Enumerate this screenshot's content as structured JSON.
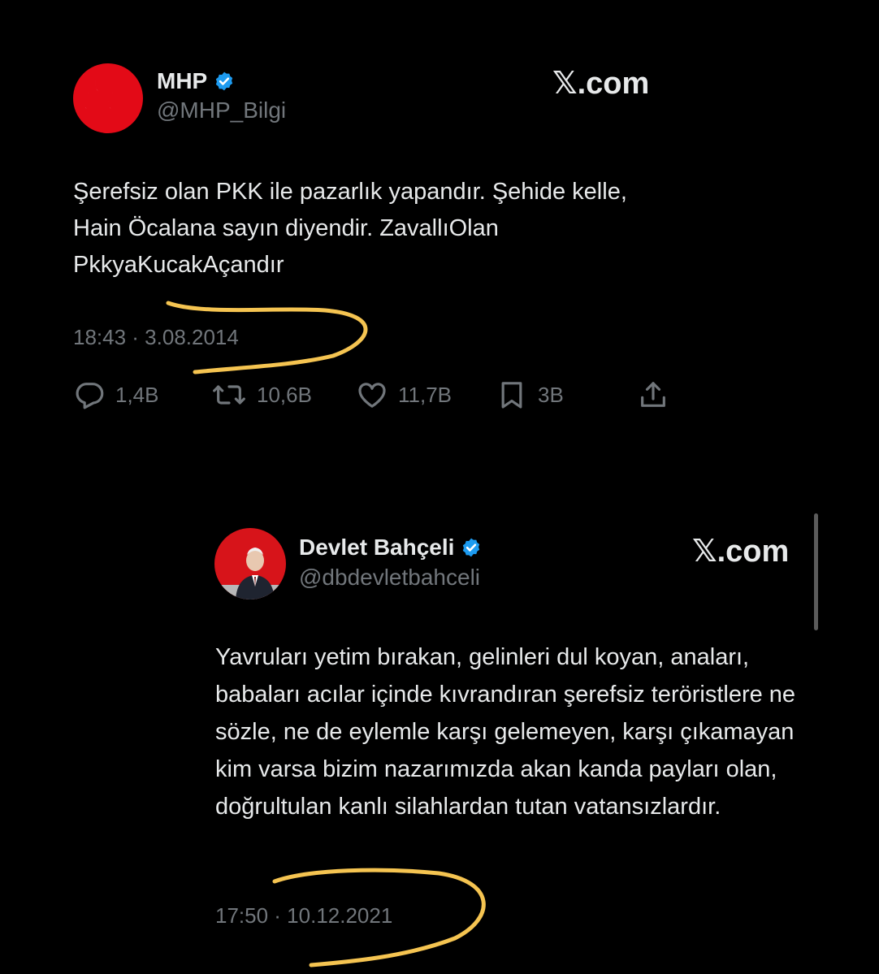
{
  "tweet1": {
    "name": "MHP",
    "handle": "@MHP_Bilgi",
    "brand": "𝕏.com",
    "text": "Şerefsiz olan PKK ile pazarlık yapandır. Şehide kelle, Hain Öcalana sayın diyendir. ZavallıOlan PkkyaKucakAçandır",
    "timestamp": "18:43 · 3.08.2014",
    "actions": {
      "replies": "1,4B",
      "reposts": "10,6B",
      "likes": "11,7B",
      "bookmarks": "3B"
    },
    "avatar_icon": "mhp-three-crescents-logo"
  },
  "tweet2": {
    "name": "Devlet Bahçeli",
    "handle": "@dbdevletbahceli",
    "brand": "𝕏.com",
    "text": "Yavruları yetim bırakan, gelinleri dul koyan, anaları, babaları acılar içinde kıvrandıran şerefsiz teröristlere ne sözle, ne de eylemle karşı gelemeyen, karşı çıkamayan kim varsa bizim nazarımızda akan kanda payları olan, doğrultulan kanlı silahlardan tutan vatansızlardır.",
    "timestamp": "17:50 · 10.12.2021",
    "avatar_icon": "profile-photo-with-flag"
  },
  "icons": {
    "verified": "verified-badge-icon",
    "reply": "reply-icon",
    "repost": "repost-icon",
    "like": "heart-icon",
    "bookmark": "bookmark-icon",
    "share": "share-icon"
  },
  "colors": {
    "background": "#000000",
    "primary_text": "#e7e9ea",
    "secondary_text": "#71767b",
    "verified_blue": "#1d9bf0",
    "mhp_red": "#e30a17",
    "highlight_scribble": "#f5c451"
  }
}
